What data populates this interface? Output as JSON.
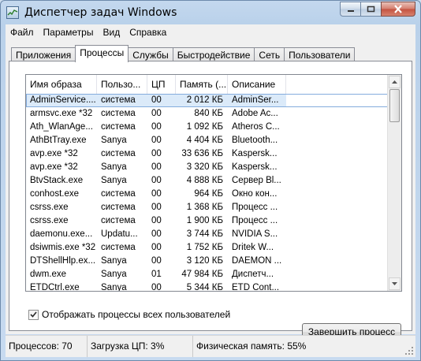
{
  "window": {
    "title": "Диспетчер задач Windows",
    "minimize_icon": "minimize-icon",
    "maximize_icon": "maximize-icon",
    "close_icon": "close-icon"
  },
  "menu": [
    "Файл",
    "Параметры",
    "Вид",
    "Справка"
  ],
  "tabs": [
    "Приложения",
    "Процессы",
    "Службы",
    "Быстродействие",
    "Сеть",
    "Пользователи"
  ],
  "active_tab": "Процессы",
  "columns": [
    "Имя образа",
    "Пользо...",
    "ЦП",
    "Память (...",
    "Описание"
  ],
  "rows": [
    [
      "AdminService....",
      "система",
      "00",
      "2 012 КБ",
      "AdminSer..."
    ],
    [
      "armsvc.exe *32",
      "система",
      "00",
      "840 КБ",
      "Adobe Ac..."
    ],
    [
      "Ath_WlanAge...",
      "система",
      "00",
      "1 092 КБ",
      "Atheros C..."
    ],
    [
      "AthBtTray.exe",
      "Sanya",
      "00",
      "4 404 КБ",
      "Bluetooth..."
    ],
    [
      "avp.exe *32",
      "система",
      "00",
      "33 636 КБ",
      "Kaspersk..."
    ],
    [
      "avp.exe *32",
      "Sanya",
      "00",
      "3 320 КБ",
      "Kaspersk..."
    ],
    [
      "BtvStack.exe",
      "Sanya",
      "00",
      "4 888 КБ",
      "Сервер Bl..."
    ],
    [
      "conhost.exe",
      "система",
      "00",
      "964 КБ",
      "Окно кон..."
    ],
    [
      "csrss.exe",
      "система",
      "00",
      "1 368 КБ",
      "Процесс ..."
    ],
    [
      "csrss.exe",
      "система",
      "00",
      "1 900 КБ",
      "Процесс ..."
    ],
    [
      "daemonu.exe...",
      "Updatu...",
      "00",
      "3 744 КБ",
      "NVIDIA S..."
    ],
    [
      "dsiwmis.exe *32",
      "система",
      "00",
      "1 752 КБ",
      "Dritek W..."
    ],
    [
      "DTShellHlp.ex...",
      "Sanya",
      "00",
      "3 120 КБ",
      "DAEMON ..."
    ],
    [
      "dwm.exe",
      "Sanya",
      "01",
      "47 984 КБ",
      "Диспетч..."
    ],
    [
      "ETDCtrl.exe",
      "Sanya",
      "00",
      "5 344 КБ",
      "ETD Cont..."
    ]
  ],
  "show_all_users_label": "Отображать процессы всех пользователей",
  "show_all_users_checked": true,
  "end_process_label": "Завершить процесс",
  "status": {
    "processes": "Процессов: 70",
    "cpu": "Загрузка ЦП: 3%",
    "memory": "Физическая память: 55%"
  }
}
